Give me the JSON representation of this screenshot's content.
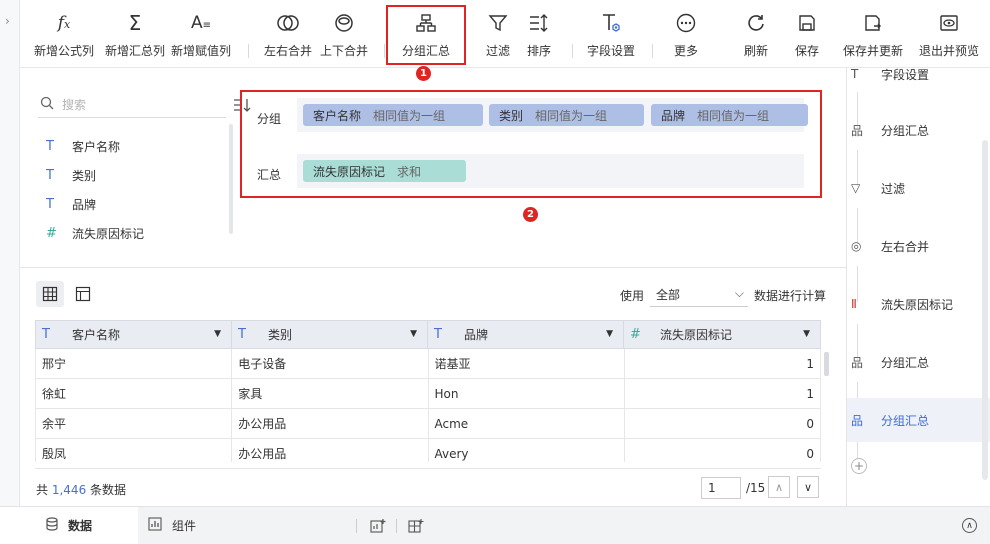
{
  "toolbar": {
    "items": [
      {
        "label": "新增公式列",
        "icon": "formula-fx-icon"
      },
      {
        "label": "新增汇总列",
        "icon": "sigma-sum-icon"
      },
      {
        "label": "新增赋值列",
        "icon": "assign-value-icon"
      },
      {
        "label": "左右合并",
        "icon": "merge-horizontal-icon"
      },
      {
        "label": "上下合并",
        "icon": "merge-vertical-icon"
      },
      {
        "label": "分组汇总",
        "icon": "group-summary-icon"
      },
      {
        "label": "过滤",
        "icon": "filter-icon"
      },
      {
        "label": "排序",
        "icon": "sort-icon"
      },
      {
        "label": "字段设置",
        "icon": "field-settings-icon"
      },
      {
        "label": "更多",
        "icon": "more-icon"
      },
      {
        "label": "刷新",
        "icon": "refresh-icon"
      },
      {
        "label": "保存",
        "icon": "save-icon"
      },
      {
        "label": "保存并更新",
        "icon": "save-update-icon"
      },
      {
        "label": "退出并预览",
        "icon": "exit-preview-icon"
      }
    ]
  },
  "annotations": {
    "badge1": "1",
    "badge2": "2"
  },
  "field_panel": {
    "search_placeholder": "搜索",
    "fields": [
      {
        "name": "客户名称",
        "type": "T"
      },
      {
        "name": "类别",
        "type": "T"
      },
      {
        "name": "品牌",
        "type": "T"
      },
      {
        "name": "流失原因标记",
        "type": "#"
      }
    ]
  },
  "group_config": {
    "group_label": "分组",
    "summary_label": "汇总",
    "group_fields": [
      {
        "name": "客户名称",
        "mode": "相同值为一组"
      },
      {
        "name": "类别",
        "mode": "相同值为一组"
      },
      {
        "name": "品牌",
        "mode": "相同值为一组"
      }
    ],
    "summary_fields": [
      {
        "name": "流失原因标记",
        "mode": "求和"
      }
    ]
  },
  "table_tools": {
    "use_label": "使用",
    "use_value": "全部",
    "calc_label": "数据进行计算"
  },
  "table": {
    "columns": [
      {
        "name": "客户名称",
        "type": "T"
      },
      {
        "name": "类别",
        "type": "T"
      },
      {
        "name": "品牌",
        "type": "T"
      },
      {
        "name": "流失原因标记",
        "type": "#"
      }
    ],
    "rows": [
      [
        "邢宁",
        "电子设备",
        "诺基亚",
        "1"
      ],
      [
        "徐虹",
        "家具",
        "Hon",
        "1"
      ],
      [
        "余平",
        "办公用品",
        "Acme",
        "0"
      ],
      [
        "殷凤",
        "办公用品",
        "Avery",
        "0"
      ]
    ]
  },
  "footer": {
    "total_prefix": "共",
    "total_count": "1,446",
    "total_suffix": "条数据",
    "page_current": "1",
    "page_total": "/15"
  },
  "right_panel": {
    "steps": [
      {
        "label": "字段设置",
        "icon": "field-settings-icon"
      },
      {
        "label": "分组汇总",
        "icon": "group-summary-icon"
      },
      {
        "label": "过滤",
        "icon": "filter-icon"
      },
      {
        "label": "左右合并",
        "icon": "merge-horizontal-icon"
      },
      {
        "label": "流失原因标记",
        "icon": "column-chart-icon"
      },
      {
        "label": "分组汇总",
        "icon": "group-summary-icon"
      },
      {
        "label": "分组汇总",
        "icon": "group-summary-icon"
      }
    ],
    "active_index": 6
  },
  "bottom_tabs": {
    "data_label": "数据",
    "component_label": "组件"
  },
  "colors": {
    "accent": "#3f6bd4",
    "annotation_red": "#e02424",
    "group_chip": "#aebfe6",
    "summary_chip": "#a9ddd6"
  }
}
